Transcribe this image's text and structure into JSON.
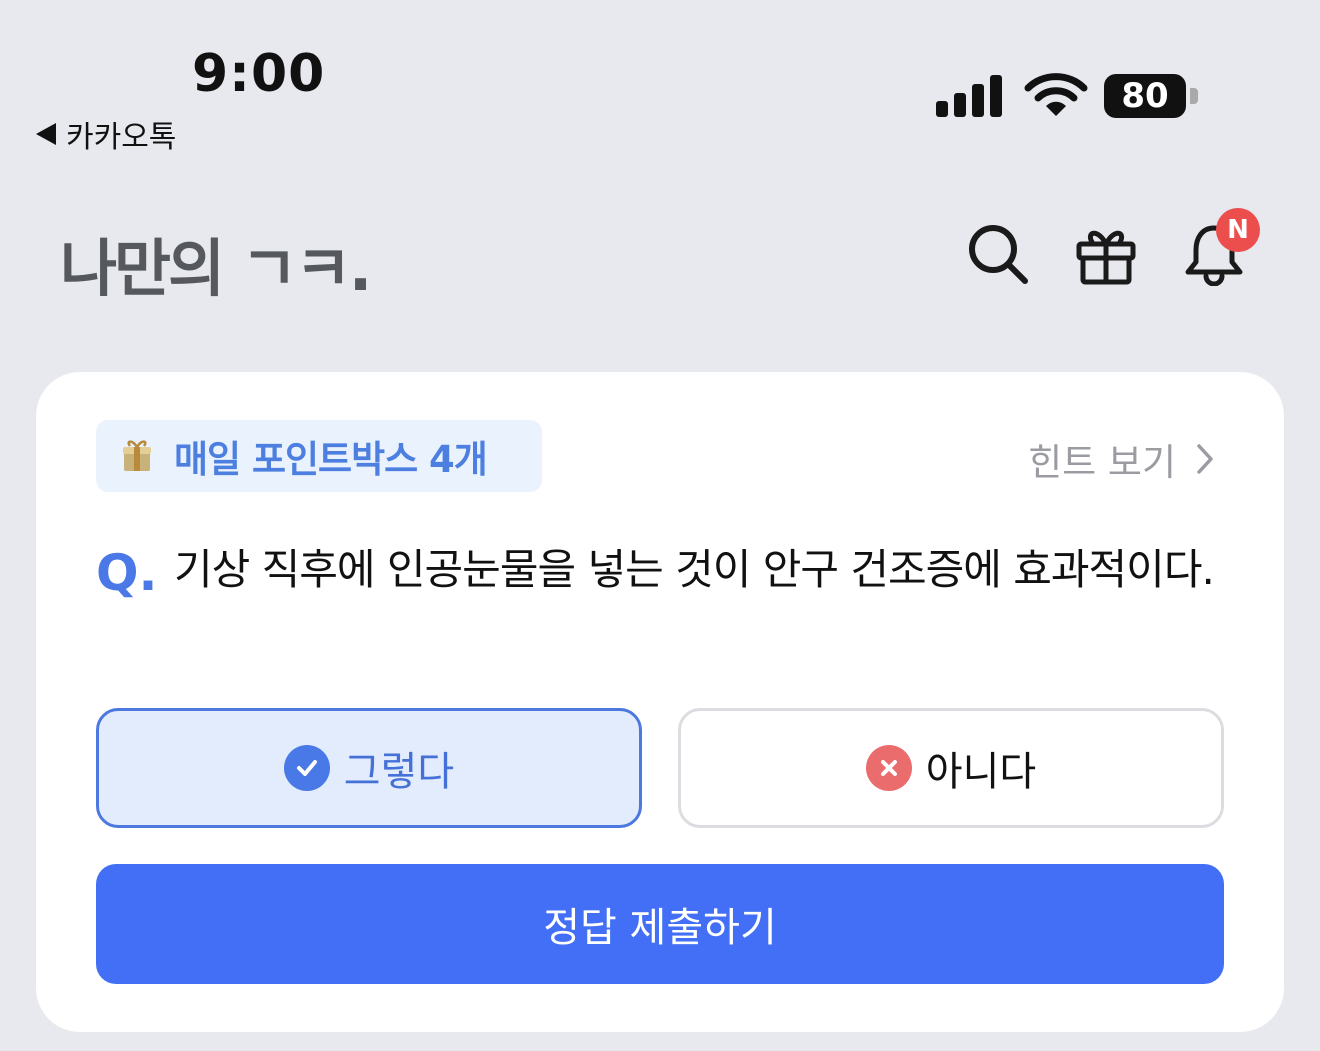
{
  "status_bar": {
    "time": "9:00",
    "back_app": "카카오톡",
    "battery": "80",
    "signal_icon": "cellular-signal-icon",
    "wifi_icon": "wifi-icon"
  },
  "header": {
    "logo": "나만의 ㄱㅋ.",
    "icons": [
      "search-icon",
      "gift-icon",
      "bell-icon"
    ],
    "notification_badge": "N"
  },
  "quiz": {
    "pointbox_icon": "gift-box-icon",
    "pointbox_label": "매일 포인트박스 4개",
    "hint_label": "힌트 보기",
    "q_prefix": "Q.",
    "question": "기상 직후에 인공눈물을 넣는 것이 안구 건조증에 효과적이다.",
    "options": [
      {
        "label": "그렇다",
        "selected": true,
        "icon": "check-circle-icon"
      },
      {
        "label": "아니다",
        "selected": false,
        "icon": "x-circle-icon"
      }
    ],
    "submit_label": "정답 제출하기"
  },
  "colors": {
    "accent": "#426ff5",
    "selected_bg": "#e2ecfd",
    "badge": "#ec4d4d",
    "no_icon": "#ea6c6c",
    "background": "#e8e9ee"
  }
}
